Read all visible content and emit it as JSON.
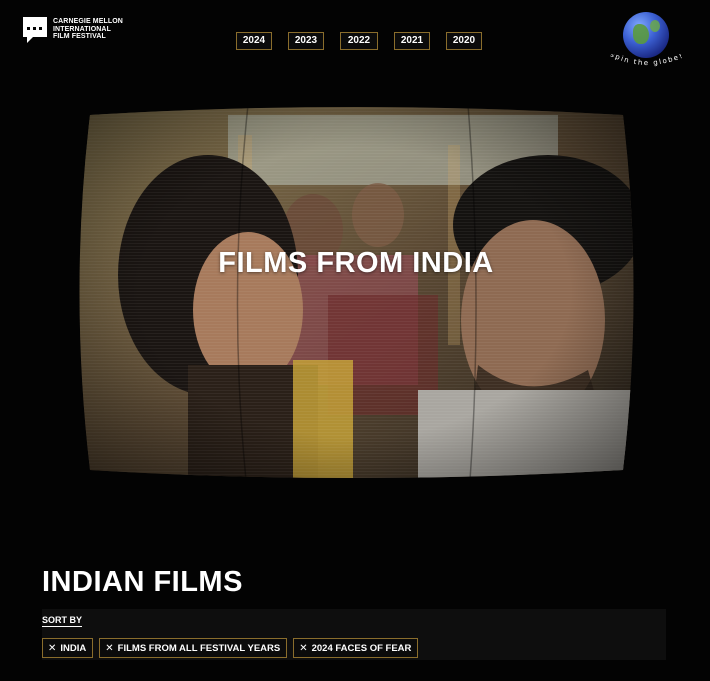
{
  "header": {
    "logo_lines": [
      "CARNEGIE MELLON",
      "INTERNATIONAL",
      "FILM FESTIVAL"
    ],
    "years": [
      "2024",
      "2023",
      "2022",
      "2021",
      "2020"
    ],
    "globe_label": "spin the globe!"
  },
  "hero": {
    "title": "FILMS FROM INDIA"
  },
  "section": {
    "title": "INDIAN FILMS",
    "sort_label": "SORT BY",
    "filters": [
      "INDIA",
      "FILMS FROM ALL FESTIVAL YEARS",
      "2024 FACES OF FEAR"
    ],
    "remove_glyph": "✕"
  },
  "colors": {
    "background": "#030303",
    "accent_border": "#8a6d2c",
    "text": "#ffffff"
  }
}
